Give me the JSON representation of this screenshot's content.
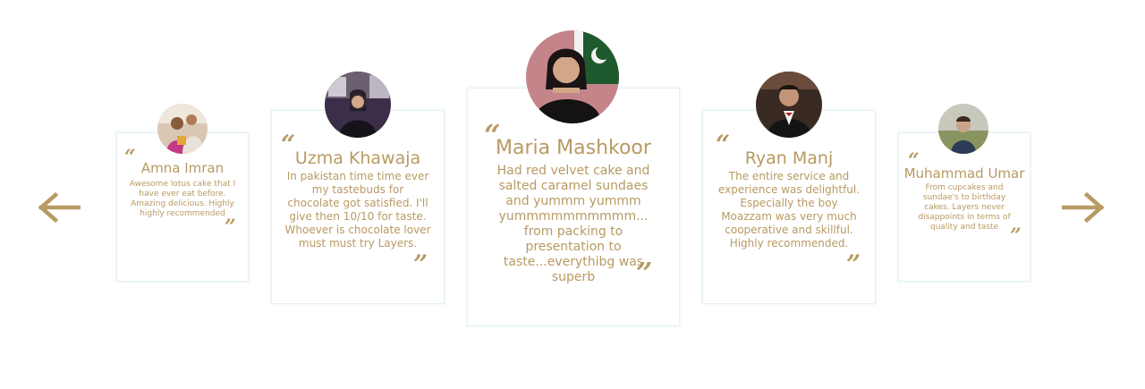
{
  "carousel": {
    "prev_icon": "arrow-left-icon",
    "next_icon": "arrow-right-icon",
    "accent_color": "#b89a62",
    "testimonials": [
      {
        "name": "Amna Imran",
        "text": "Awesome lotus cake that I have ever eat before. Amazing delicious. Highly highly recommended",
        "open_quote": "“",
        "close_quote": "”"
      },
      {
        "name": "Uzma Khawaja",
        "text": "In pakistan time time ever my tastebuds for chocolate got satisfied. I'll give then 10/10 for taste. Whoever is chocolate lover must must try Layers.",
        "open_quote": "“",
        "close_quote": "”"
      },
      {
        "name": "Maria Mashkoor",
        "text": "Had red velvet cake and salted caramel sundaes and yummm yummm yummmmmmmmmm... from packing to presentation to taste...everythibg was superb",
        "open_quote": "“",
        "close_quote": "”"
      },
      {
        "name": "Ryan Manj",
        "text": "The entire service and experience was delightful. Especially the boy Moazzam was very much cooperative and skillful. Highly recommended.",
        "open_quote": "“",
        "close_quote": "”"
      },
      {
        "name": "Muhammad Umar",
        "text": "From cupcakes and sundae's to birthday cakes. Layers never disappoints in terms of quality and taste",
        "open_quote": "“",
        "close_quote": "”"
      }
    ]
  }
}
